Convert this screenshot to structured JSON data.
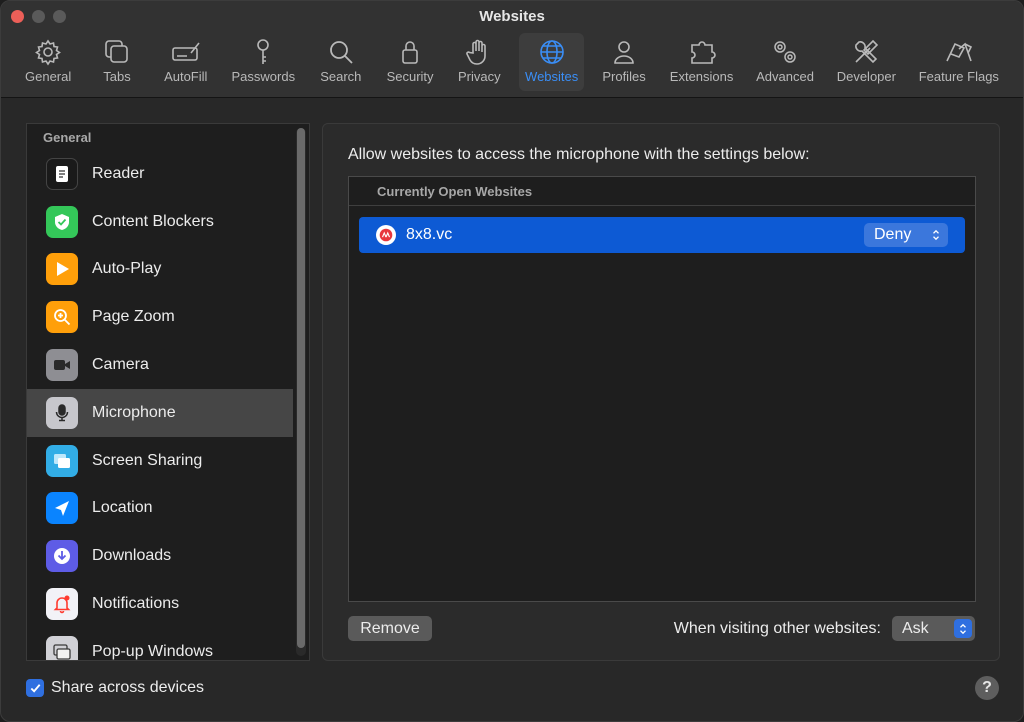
{
  "window": {
    "title": "Websites"
  },
  "toolbar": {
    "items": [
      {
        "label": "General",
        "icon": "gear-icon"
      },
      {
        "label": "Tabs",
        "icon": "tabs-icon"
      },
      {
        "label": "AutoFill",
        "icon": "autofill-icon"
      },
      {
        "label": "Passwords",
        "icon": "key-icon"
      },
      {
        "label": "Search",
        "icon": "search-icon"
      },
      {
        "label": "Security",
        "icon": "lock-icon"
      },
      {
        "label": "Privacy",
        "icon": "hand-icon"
      },
      {
        "label": "Websites",
        "icon": "globe-icon",
        "active": true
      },
      {
        "label": "Profiles",
        "icon": "person-icon"
      },
      {
        "label": "Extensions",
        "icon": "puzzle-icon"
      },
      {
        "label": "Advanced",
        "icon": "gears-icon"
      },
      {
        "label": "Developer",
        "icon": "tools-icon"
      },
      {
        "label": "Feature Flags",
        "icon": "flags-icon"
      }
    ]
  },
  "sidebar": {
    "header": "General",
    "items": [
      {
        "label": "Reader",
        "icon": "reader-icon",
        "color": "#1a1a1a"
      },
      {
        "label": "Content Blockers",
        "icon": "shield-check-icon",
        "color": "#34c759"
      },
      {
        "label": "Auto-Play",
        "icon": "play-icon",
        "color": "#ff9f0a"
      },
      {
        "label": "Page Zoom",
        "icon": "zoom-icon",
        "color": "#ff9f0a"
      },
      {
        "label": "Camera",
        "icon": "camera-icon",
        "color": "#8e8e93"
      },
      {
        "label": "Microphone",
        "icon": "microphone-icon",
        "color": "#c7c7cc",
        "selected": true
      },
      {
        "label": "Screen Sharing",
        "icon": "screen-sharing-icon",
        "color": "#32ade6"
      },
      {
        "label": "Location",
        "icon": "location-arrow-icon",
        "color": "#0a84ff"
      },
      {
        "label": "Downloads",
        "icon": "download-icon",
        "color": "#5e5ce6"
      },
      {
        "label": "Notifications",
        "icon": "bell-icon",
        "color": "#f2f2f7"
      },
      {
        "label": "Pop-up Windows",
        "icon": "popup-windows-icon",
        "color": "#d1d1d6"
      }
    ]
  },
  "main": {
    "description": "Allow websites to access the microphone with the settings below:",
    "table_header": "Currently Open Websites",
    "rows": [
      {
        "site": "8x8.vc",
        "setting": "Deny"
      }
    ],
    "remove_label": "Remove",
    "other_label": "When visiting other websites:",
    "other_value": "Ask"
  },
  "footer": {
    "share_label": "Share across devices",
    "share_checked": true,
    "help_label": "?"
  },
  "colors": {
    "accent": "#3a8ef6",
    "selection": "#0d5ad4",
    "close": "#ec5f58"
  }
}
